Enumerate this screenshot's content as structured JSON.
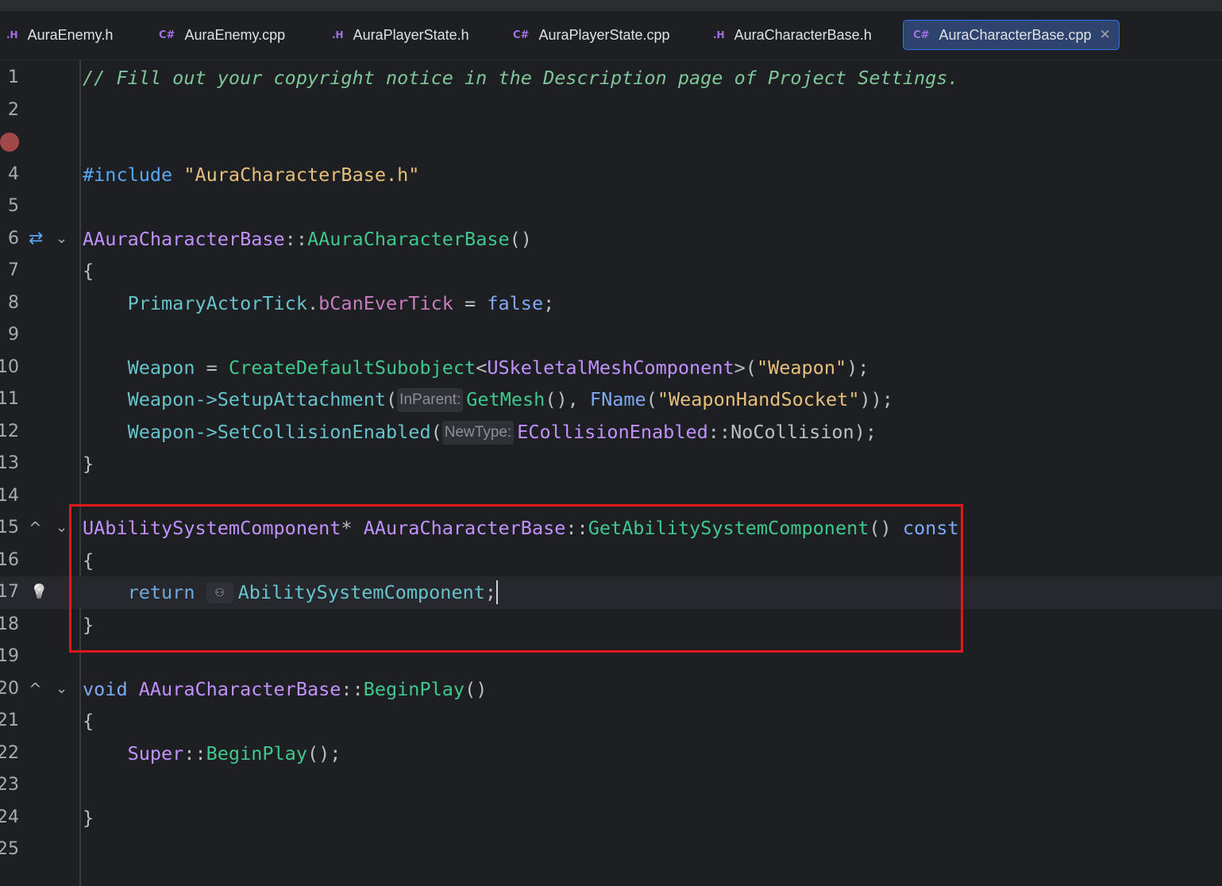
{
  "tabs": [
    {
      "icon": ".H",
      "label": "AuraEnemy.h"
    },
    {
      "icon": "C#",
      "label": "AuraEnemy.cpp"
    },
    {
      "icon": ".H",
      "label": "AuraPlayerState.h"
    },
    {
      "icon": "C#",
      "label": "AuraPlayerState.cpp"
    },
    {
      "icon": ".H",
      "label": "AuraCharacterBase.h"
    },
    {
      "icon": "C#",
      "label": "AuraCharacterBase.cpp",
      "active": true
    }
  ],
  "tab_close_glyph": "✕",
  "line_numbers": [
    "1",
    "2",
    "",
    "4",
    "5",
    "6",
    "7",
    "8",
    "9",
    "10",
    "11",
    "12",
    "13",
    "14",
    "15",
    "16",
    "17",
    "18",
    "19",
    "20",
    "21",
    "22",
    "23",
    "24",
    "25",
    ""
  ],
  "code": {
    "l1": "// Fill out your copyright notice in the Description page of Project Settings.",
    "l4_kw": "#include",
    "l4_str": "\"AuraCharacterBase.h\"",
    "l6_class": "AAuraCharacterBase",
    "l6_sep": "::",
    "l6_fn": "AAuraCharacterBase",
    "l6_paren": "()",
    "brace_open": "{",
    "brace_close": "}",
    "l8_obj": "PrimaryActorTick",
    "l8_dot": ".",
    "l8_field": "bCanEverTick",
    "l8_eq": " = ",
    "l8_val": "false",
    "l8_semi": ";",
    "l10_var": "Weapon",
    "l10_eq": " = ",
    "l10_fn": "CreateDefaultSubobject",
    "l10_lt": "<",
    "l10_type": "USkeletalMeshComponent",
    "l10_gt": ">",
    "l10_open": "(",
    "l10_str": "\"Weapon\"",
    "l10_close": ");",
    "l11_var": "Weapon",
    "l11_arrow": "->",
    "l11_fn": "SetupAttachment",
    "l11_open": "(",
    "l11_hint": "InParent:",
    "l11_fn2": "GetMesh",
    "l11_mid": "(), ",
    "l11_type": "FName",
    "l11_open2": "(",
    "l11_str": "\"WeaponHandSocket\"",
    "l11_close": "));",
    "l12_var": "Weapon",
    "l12_arrow": "->",
    "l12_fn": "SetCollisionEnabled",
    "l12_open": "(",
    "l12_hint": "NewType:",
    "l12_enum": "ECollisionEnabled",
    "l12_sep": "::",
    "l12_val": "NoCollision",
    "l12_close": ");",
    "l15_type": "UAbilitySystemComponent",
    "l15_star": "* ",
    "l15_class": "AAuraCharacterBase",
    "l15_sep": "::",
    "l15_fn": "GetAbilitySystemComponent",
    "l15_paren": "() ",
    "l15_const": "const",
    "l17_ret": "return",
    "l17_icon": "⚇",
    "l17_field": "AbilitySystemComponent",
    "l17_semi": ";",
    "l20_void": "void",
    "l20_class": "AAuraCharacterBase",
    "l20_sep": "::",
    "l20_fn": "BeginPlay",
    "l20_paren": "()",
    "l22_super": "Super",
    "l22_sep": "::",
    "l22_fn": "BeginPlay",
    "l22_end": "();"
  },
  "gutter_icons": {
    "override_impl": "⇄",
    "fold": "⌄",
    "up_impl": "^",
    "bulb": "💡"
  },
  "colors": {
    "background": "#1e1f22",
    "active_tab": "#2e436e",
    "highlight_box": "#e0191d",
    "breakpoint": "#a34848"
  }
}
